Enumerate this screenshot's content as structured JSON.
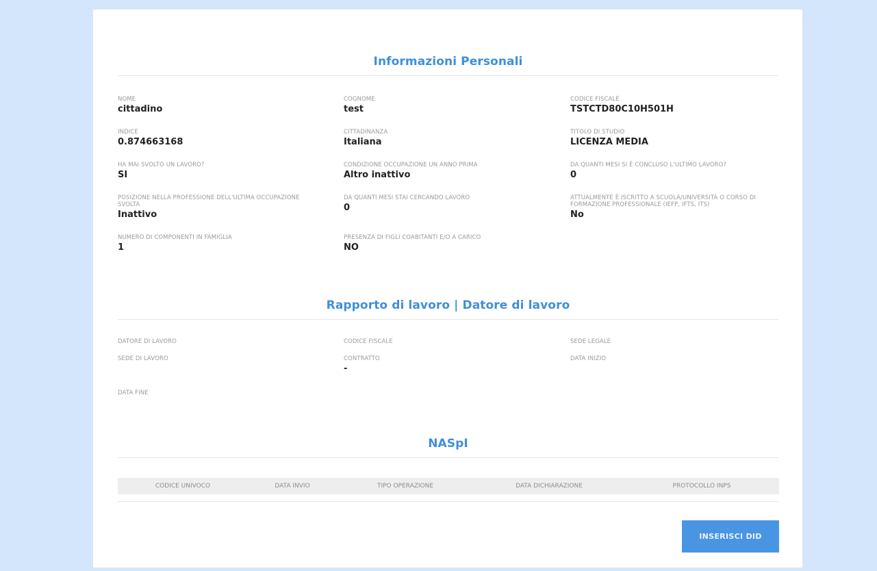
{
  "personal": {
    "title": "Informazioni Personali",
    "fields": [
      {
        "label": "Nome",
        "value": "cittadino"
      },
      {
        "label": "Cognome",
        "value": "test"
      },
      {
        "label": "Codice Fiscale",
        "value": "TSTCTD80C10H501H"
      },
      {
        "label": "Indice",
        "value": "0.874663168"
      },
      {
        "label": "Cittadinanza",
        "value": "Italiana"
      },
      {
        "label": "Titolo di studio",
        "value": "LICENZA MEDIA"
      },
      {
        "label": "Ha mai svolto un lavoro?",
        "value": "SI"
      },
      {
        "label": "Condizione occupazione un anno prima",
        "value": "Altro inattivo"
      },
      {
        "label": "Da quanti mesi si è concluso l'ultimo lavoro?",
        "value": "0"
      },
      {
        "label": "Posizione nella professione dell'ultima occupazione svolta",
        "value": "Inattivo"
      },
      {
        "label": "Da quanti mesi stai cercando lavoro",
        "value": "0"
      },
      {
        "label": "Attualmente è iscritto a scuola/università o corso di formazione professionale (IeFP, IFTS, ITS)",
        "value": "No"
      },
      {
        "label": "Numero di componenti in famiglia",
        "value": "1"
      },
      {
        "label": "Presenza di figli coabitanti e/o a carico",
        "value": "NO"
      }
    ]
  },
  "employment": {
    "title": "Rapporto di lavoro | Datore di lavoro",
    "fields": [
      {
        "label": "Datore di lavoro",
        "value": ""
      },
      {
        "label": "Codice fiscale",
        "value": ""
      },
      {
        "label": "Sede legale",
        "value": ""
      },
      {
        "label": "Sede di lavoro",
        "value": ""
      },
      {
        "label": "Contratto",
        "value": "-"
      },
      {
        "label": "Data inizio",
        "value": ""
      },
      {
        "label": "Data fine",
        "value": ""
      }
    ]
  },
  "naspi": {
    "title": "NASpI",
    "columns": [
      "Codice univoco",
      "Data invio",
      "Tipo operazione",
      "Data dichiarazione",
      "Protocollo INPS"
    ]
  },
  "actions": {
    "insert_label": "Inserisci DID"
  },
  "colors": {
    "accent": "#3f8fd9",
    "button": "#4a95e3",
    "background": "#d3e6fb"
  }
}
